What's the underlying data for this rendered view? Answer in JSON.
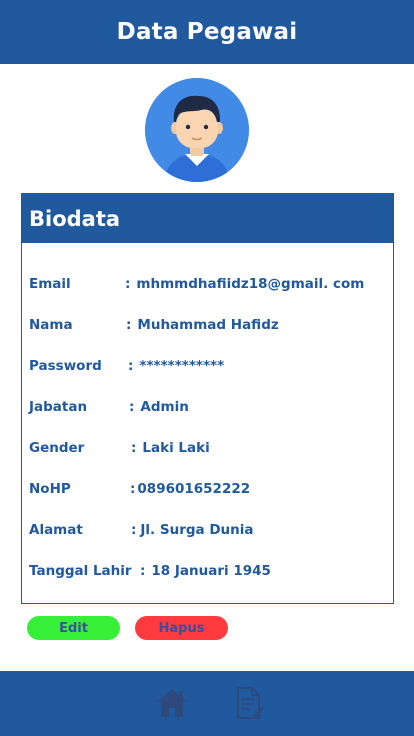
{
  "header": {
    "title": "Data Pegawai"
  },
  "card": {
    "title": "Biodata",
    "rows": [
      {
        "label": "Email",
        "value": "mhmmdhafiidz18@gmail. com"
      },
      {
        "label": "Nama",
        "value": "Muhammad Hafidz"
      },
      {
        "label": "Password",
        "value": "************"
      },
      {
        "label": "Jabatan",
        "value": "Admin"
      },
      {
        "label": "Gender",
        "value": "Laki Laki"
      },
      {
        "label": "NoHP",
        "value": "089601652222"
      },
      {
        "label": "Alamat",
        "value": "Jl. Surga Dunia"
      },
      {
        "label": "Tanggal Lahir",
        "value": "18 Januari 1945"
      }
    ],
    "separator": ":"
  },
  "actions": {
    "edit_label": "Edit",
    "delete_label": "Hapus"
  },
  "nav": {
    "home_icon": "home-icon",
    "document_icon": "document-icon"
  },
  "colors": {
    "primary": "#21599f",
    "edit": "#37ef37",
    "delete": "#ff3b3f",
    "icon": "#2e4a7d"
  }
}
